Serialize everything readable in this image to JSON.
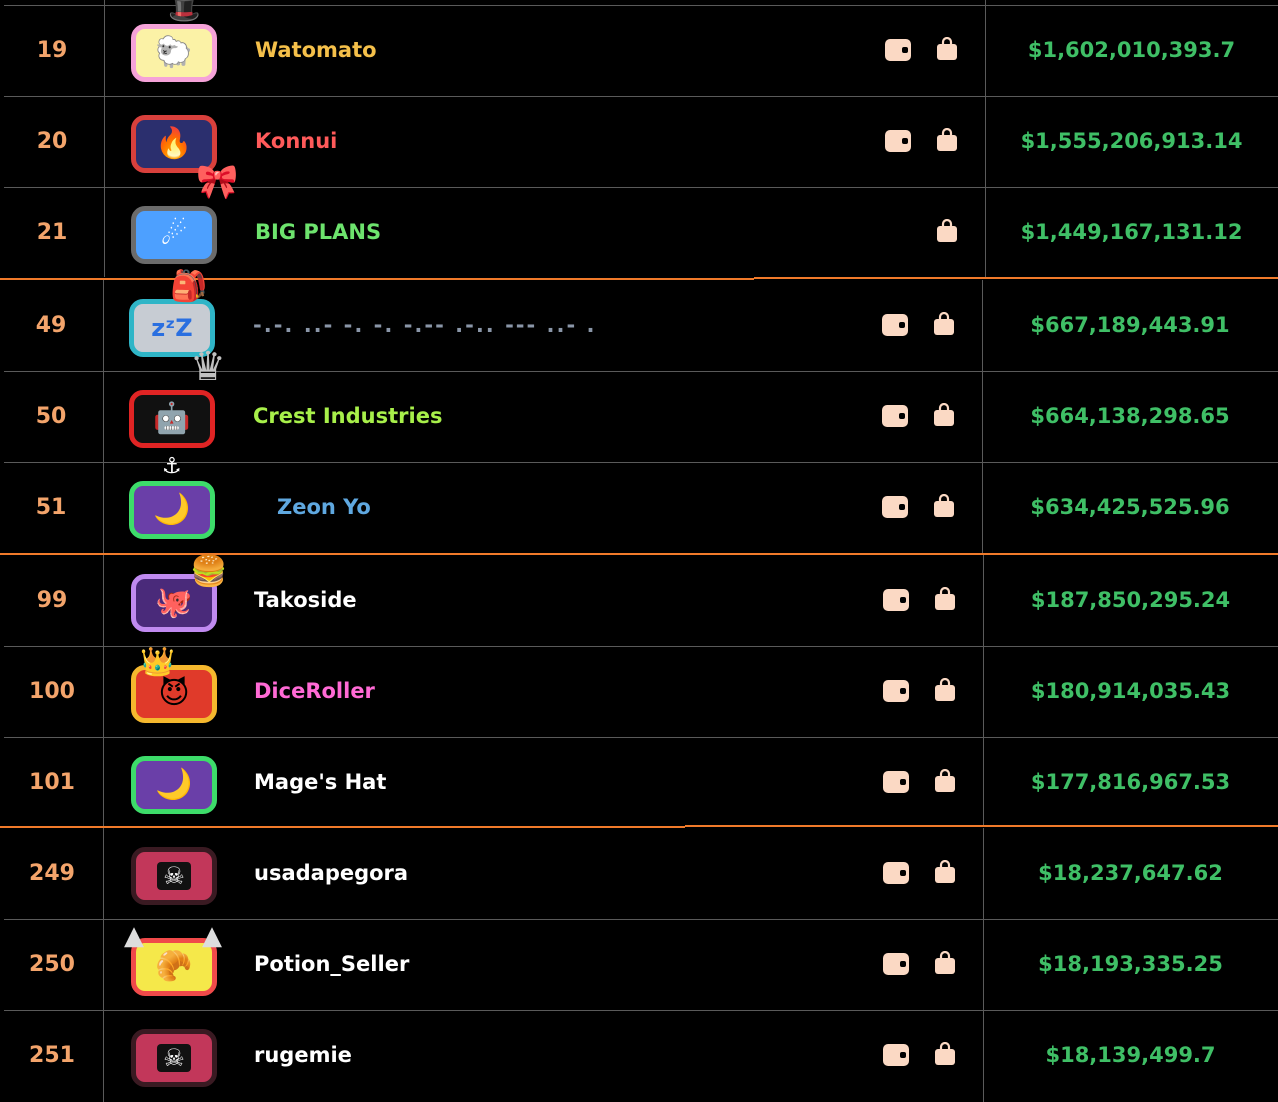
{
  "colors": {
    "rank": "#f3a46b",
    "money": "#3fbf66",
    "separator": "#f07a2a",
    "icon_fill": "#fbd9c4"
  },
  "rows": [
    {
      "rank": "19",
      "name": "Watomato",
      "name_color": "#f5c04a",
      "money": "$1,602,010,393.7",
      "avatar": {
        "icon": "sheep-icon",
        "glyph": "🐑",
        "bg": "#fbf2a6",
        "border": "#f5a2d8"
      },
      "wallet": true,
      "bag": true
    },
    {
      "rank": "20",
      "name": "Konnui",
      "name_color": "#ff5a5a",
      "money": "$1,555,206,913.14",
      "avatar": {
        "icon": "fire-icon",
        "glyph": "🔥",
        "bg": "#2b2f6e",
        "border": "#d8403c"
      },
      "wallet": true,
      "bag": true
    },
    {
      "rank": "21",
      "name": "BIG PLANS",
      "name_color": "#6de36d",
      "money": "$1,449,167,131.12",
      "avatar": {
        "icon": "comet-icon",
        "glyph": "☄",
        "bg": "#4da0ff",
        "border": "#6b6b6b"
      },
      "wallet": false,
      "bag": true
    },
    {
      "rank": "49",
      "name": "-.-. ..- -. -. -.-- .-.. --- ..- .",
      "name_color": "#8a96a8",
      "money": "$667,189,443.91",
      "avatar": {
        "icon": "sleep-icon",
        "glyph": "💤",
        "bg": "#c7ccd3",
        "border": "#2fb5c7"
      },
      "wallet": true,
      "bag": true
    },
    {
      "rank": "50",
      "name": "Crest Industries",
      "name_color": "#a8f04a",
      "money": "$664,138,298.65",
      "avatar": {
        "icon": "robot-icon",
        "glyph": "🤖",
        "bg": "#111111",
        "border": "#e02424"
      },
      "wallet": true,
      "bag": true
    },
    {
      "rank": "51",
      "name": "Zeon Yo",
      "name_color": "#5fa8e0",
      "money": "$634,425,525.96",
      "avatar": {
        "icon": "moon-icon",
        "glyph": "🌙",
        "bg": "#6a3fa8",
        "border": "#3ddc6a"
      },
      "wallet": true,
      "bag": true
    },
    {
      "rank": "99",
      "name": "Takoside",
      "name_color": "#ffffff",
      "money": "$187,850,295.24",
      "avatar": {
        "icon": "octopus-icon",
        "glyph": "🐙",
        "bg": "#4a2a7a",
        "border": "#c08af0"
      },
      "wallet": true,
      "bag": true
    },
    {
      "rank": "100",
      "name": "DiceRoller",
      "name_color": "#ff6ad5",
      "money": "$180,914,035.43",
      "avatar": {
        "icon": "devil-icon",
        "glyph": "😈",
        "bg": "#e03a2a",
        "border": "#f5b82e"
      },
      "wallet": true,
      "bag": true
    },
    {
      "rank": "101",
      "name": "Mage's Hat",
      "name_color": "#ffffff",
      "money": "$177,816,967.53",
      "avatar": {
        "icon": "moon-icon",
        "glyph": "🌙",
        "bg": "#6a3fa8",
        "border": "#3ddc6a"
      },
      "wallet": true,
      "bag": true
    },
    {
      "rank": "249",
      "name": "usadapegora",
      "name_color": "#ffffff",
      "money": "$18,237,647.62",
      "avatar": {
        "icon": "skull-crossbones-icon",
        "glyph": "☠",
        "bg": "#c2375a",
        "border": "#3a1a22"
      },
      "wallet": true,
      "bag": true
    },
    {
      "rank": "250",
      "name": "Potion_Seller",
      "name_color": "#ffffff",
      "money": "$18,193,335.25",
      "avatar": {
        "icon": "croissant-icon",
        "glyph": "🥐",
        "bg": "#f5e84a",
        "border": "#f04a4a"
      },
      "wallet": true,
      "bag": true
    },
    {
      "rank": "251",
      "name": "rugemie",
      "name_color": "#ffffff",
      "money": "$18,139,499.7",
      "avatar": {
        "icon": "skull-crossbones-icon",
        "glyph": "☠",
        "bg": "#c2375a",
        "border": "#3a1a22"
      },
      "wallet": true,
      "bag": true
    }
  ]
}
